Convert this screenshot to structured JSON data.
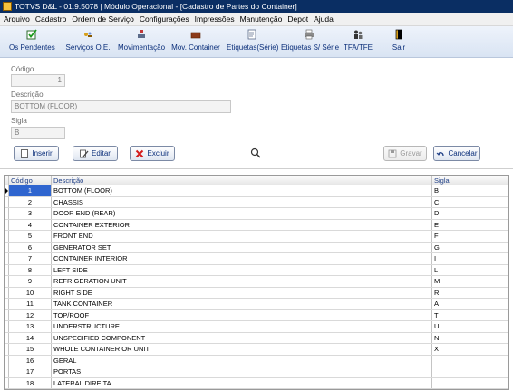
{
  "window": {
    "title": "TOTVS D&L - 01.9.5078 | Módulo Operacional - [Cadastro de Partes do Container]"
  },
  "menu": [
    "Arquivo",
    "Cadastro",
    "Ordem de Serviço",
    "Configurações",
    "Impressões",
    "Manutenção",
    "Depot",
    "Ajuda"
  ],
  "toolbar": {
    "buttons": [
      {
        "label": "Os Pendentes",
        "icon": "checkbox-icon"
      },
      {
        "label": "Serviços O.E.",
        "icon": "tools-icon"
      },
      {
        "label": "Movimentação",
        "icon": "move-icon"
      },
      {
        "label": "Mov. Container",
        "icon": "container-icon"
      },
      {
        "label": "Etiquetas(Série)",
        "icon": "labels-icon"
      },
      {
        "label": "Etiquetas S/ Série",
        "icon": "printer-icon"
      },
      {
        "label": "TFA/TFE",
        "icon": "people-icon"
      },
      {
        "label": "Sair",
        "icon": "exit-icon"
      }
    ]
  },
  "form": {
    "codigo_label": "Código",
    "codigo_value": "1",
    "descricao_label": "Descrição",
    "descricao_value": "BOTTOM (FLOOR)",
    "sigla_label": "Sigla",
    "sigla_value": "B"
  },
  "actions": {
    "inserir": "Inserir",
    "editar": "Editar",
    "excluir": "Excluir",
    "gravar": "Gravar",
    "cancelar": "Cancelar"
  },
  "colors": {
    "accent": "#0b2f7a",
    "selected": "#2f65cf",
    "titlebar": "#0a2e63"
  },
  "grid": {
    "headers": {
      "codigo": "Código",
      "descricao": "Descrição",
      "sigla": "Sigla"
    },
    "rows": [
      {
        "codigo": "1",
        "descricao": "BOTTOM (FLOOR)",
        "sigla": "B"
      },
      {
        "codigo": "2",
        "descricao": "CHASSIS",
        "sigla": "C"
      },
      {
        "codigo": "3",
        "descricao": "DOOR END (REAR)",
        "sigla": "D"
      },
      {
        "codigo": "4",
        "descricao": "CONTAINER EXTERIOR",
        "sigla": "E"
      },
      {
        "codigo": "5",
        "descricao": "FRONT END",
        "sigla": "F"
      },
      {
        "codigo": "6",
        "descricao": "GENERATOR SET",
        "sigla": "G"
      },
      {
        "codigo": "7",
        "descricao": "CONTAINER INTERIOR",
        "sigla": "I"
      },
      {
        "codigo": "8",
        "descricao": "LEFT SIDE",
        "sigla": "L"
      },
      {
        "codigo": "9",
        "descricao": "REFRIGERATION UNIT",
        "sigla": "M"
      },
      {
        "codigo": "10",
        "descricao": "RIGHT SIDE",
        "sigla": "R"
      },
      {
        "codigo": "11",
        "descricao": "TANK CONTAINER",
        "sigla": "A"
      },
      {
        "codigo": "12",
        "descricao": "TOP/ROOF",
        "sigla": "T"
      },
      {
        "codigo": "13",
        "descricao": "UNDERSTRUCTURE",
        "sigla": "U"
      },
      {
        "codigo": "14",
        "descricao": "UNSPECIFIED COMPONENT",
        "sigla": "N"
      },
      {
        "codigo": "15",
        "descricao": "WHOLE CONTAINER OR UNIT",
        "sigla": "X"
      },
      {
        "codigo": "16",
        "descricao": "GERAL",
        "sigla": ""
      },
      {
        "codigo": "17",
        "descricao": "PORTAS",
        "sigla": ""
      },
      {
        "codigo": "18",
        "descricao": "LATERAL DIREITA",
        "sigla": ""
      }
    ]
  }
}
